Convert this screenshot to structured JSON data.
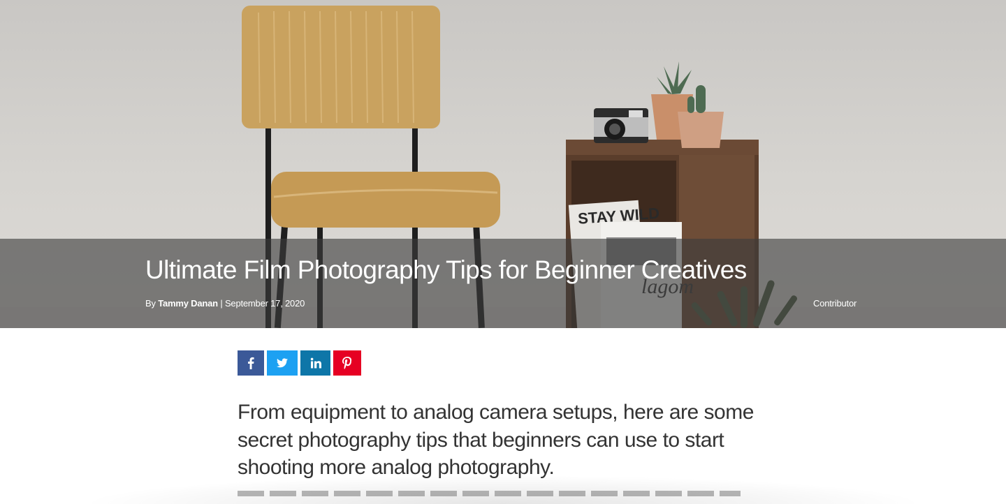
{
  "hero": {
    "title": "Ultimate Film Photography Tips for Beginner Creatives",
    "byline_prefix": "By",
    "author": "Tammy Danan",
    "separator": "|",
    "date": "September 17, 2020",
    "role": "Contributor",
    "photo_sign_text": "STAY WILD",
    "photo_magazine_text": "lagom"
  },
  "share": {
    "facebook_icon": "facebook-icon",
    "twitter_icon": "twitter-icon",
    "linkedin_icon": "linkedin-icon",
    "pinterest_icon": "pinterest-icon",
    "colors": {
      "facebook": "#3b5998",
      "twitter": "#1da1f2",
      "linkedin": "#0e76a8",
      "pinterest": "#e60023"
    }
  },
  "intro": {
    "text": "From equipment to analog camera setups, here are some secret photography tips that beginners can use to start shooting more analog photography."
  }
}
